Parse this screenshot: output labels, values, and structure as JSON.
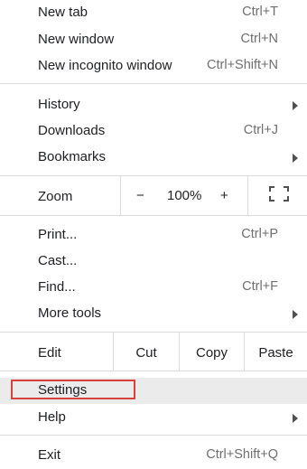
{
  "menu": {
    "new_tab": {
      "label": "New tab",
      "shortcut": "Ctrl+T"
    },
    "new_window": {
      "label": "New window",
      "shortcut": "Ctrl+N"
    },
    "new_incognito": {
      "label": "New incognito window",
      "shortcut": "Ctrl+Shift+N"
    },
    "history": {
      "label": "History"
    },
    "downloads": {
      "label": "Downloads",
      "shortcut": "Ctrl+J"
    },
    "bookmarks": {
      "label": "Bookmarks"
    },
    "zoom": {
      "label": "Zoom",
      "minus": "−",
      "value": "100%",
      "plus": "+",
      "fullscreen_icon": "fullscreen-icon"
    },
    "print": {
      "label": "Print...",
      "shortcut": "Ctrl+P"
    },
    "cast": {
      "label": "Cast..."
    },
    "find": {
      "label": "Find...",
      "shortcut": "Ctrl+F"
    },
    "more_tools": {
      "label": "More tools"
    },
    "edit": {
      "label": "Edit",
      "cut": "Cut",
      "copy": "Copy",
      "paste": "Paste"
    },
    "settings": {
      "label": "Settings"
    },
    "help": {
      "label": "Help"
    },
    "exit": {
      "label": "Exit",
      "shortcut": "Ctrl+Shift+Q"
    }
  },
  "colors": {
    "highlight": "#ebebeb",
    "annotation_box": "#d9413c"
  }
}
